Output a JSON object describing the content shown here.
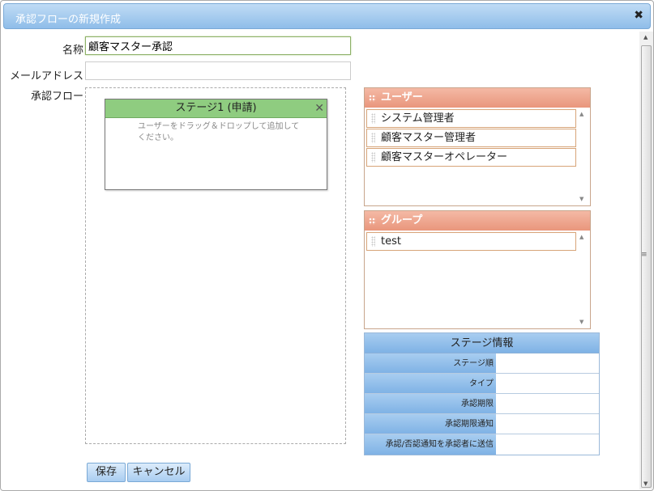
{
  "dialog": {
    "title": "承認フローの新規作成",
    "close_glyph": "✖"
  },
  "form": {
    "name_label": "名称",
    "name_value": "顧客マスター承認",
    "email_label": "メールアドレス",
    "email_value": "",
    "flow_label": "承認フロー"
  },
  "stage": {
    "title": "ステージ1 (申請)",
    "close_glyph": "✕",
    "hint": "ユーザーをドラッグ＆ドロップして追加してください。"
  },
  "users_panel": {
    "title": "ユーザー",
    "items": [
      "システム管理者",
      "顧客マスター管理者",
      "顧客マスターオペレーター"
    ]
  },
  "groups_panel": {
    "title": "グループ",
    "items": [
      "test"
    ]
  },
  "stage_info": {
    "title": "ステージ情報",
    "rows": [
      {
        "label": "ステージ順",
        "value": ""
      },
      {
        "label": "タイプ",
        "value": ""
      },
      {
        "label": "承認期限",
        "value": ""
      },
      {
        "label": "承認期限通知",
        "value": ""
      },
      {
        "label": "承認/否認通知を承認者に送信",
        "value": ""
      }
    ]
  },
  "buttons": {
    "save": "保存",
    "cancel": "キャンセル"
  },
  "colors": {
    "titlebar": "#8fbde9",
    "stage_head": "#8fcc80",
    "panel_head": "#e9967c",
    "info_head": "#7fb2e5"
  }
}
